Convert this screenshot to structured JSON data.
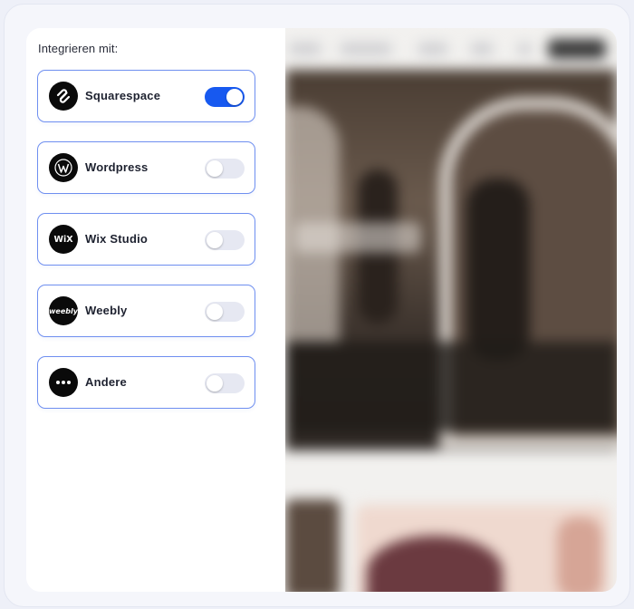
{
  "panel": {
    "title": "Integrieren mit:"
  },
  "integrations": [
    {
      "label": "Squarespace",
      "icon": "squarespace-logo-icon",
      "enabled": true
    },
    {
      "label": "Wordpress",
      "icon": "wordpress-logo-icon",
      "enabled": false
    },
    {
      "label": "Wix Studio",
      "icon": "wix-logo-icon",
      "logo_text": "WiX",
      "enabled": false
    },
    {
      "label": "Weebly",
      "icon": "weebly-logo-icon",
      "logo_text": "weebly",
      "enabled": false
    },
    {
      "label": "Andere",
      "icon": "more-dots-icon",
      "enabled": false
    }
  ],
  "colors": {
    "accent": "#1759f0",
    "item_border": "#6f8ff0",
    "toggle_off": "#e6e8f2",
    "logo_bg": "#0a0a0a"
  }
}
